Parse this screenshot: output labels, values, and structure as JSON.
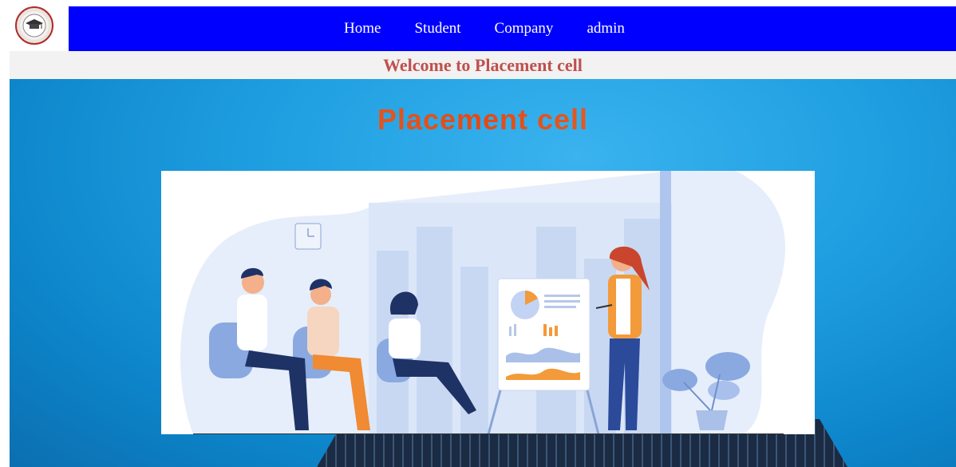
{
  "logo": {
    "icon": "graduation-cap-icon",
    "alt": "college-logo"
  },
  "nav": {
    "items": [
      {
        "label": "Home"
      },
      {
        "label": "Student"
      },
      {
        "label": "Company"
      },
      {
        "label": "admin"
      }
    ],
    "background": "#0000ff"
  },
  "welcome": {
    "text": "Welcome to Placement cell",
    "color": "#c0504d"
  },
  "hero": {
    "title": "Placement cell",
    "title_color": "#e8641e",
    "illustration": "team-meeting-presentation-illustration"
  }
}
